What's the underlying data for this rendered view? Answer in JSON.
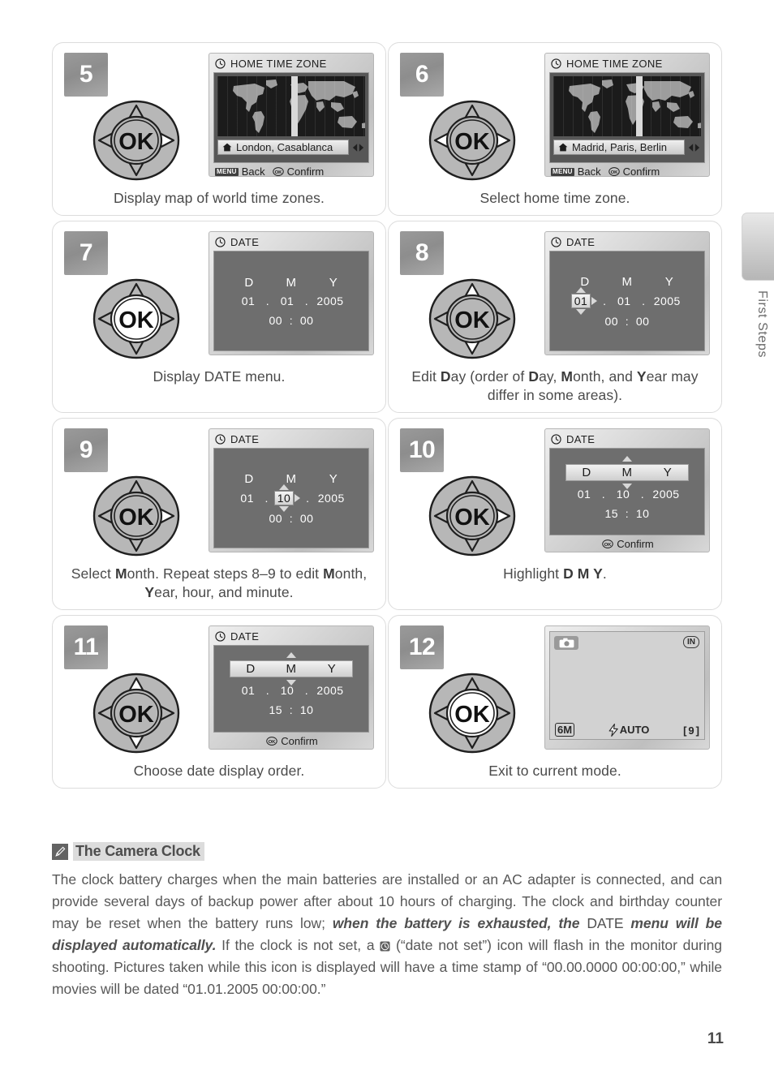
{
  "page": {
    "number": "11",
    "side_tab_label": "First Steps"
  },
  "steps": [
    {
      "number": "5",
      "caption": "Display map of world time zones.",
      "selector_highlight": "right",
      "screen": {
        "type": "timezone",
        "title": "HOME TIME ZONE",
        "zone": "London, Casablanca",
        "back_label": "Back",
        "confirm_label": "Confirm",
        "menu_tag": "MENU",
        "band_position_pct": 50
      }
    },
    {
      "number": "6",
      "caption": "Select home time zone.",
      "selector_highlight": "left-right",
      "screen": {
        "type": "timezone",
        "title": "HOME TIME ZONE",
        "zone": "Madrid, Paris, Berlin",
        "back_label": "Back",
        "confirm_label": "Confirm",
        "menu_tag": "MENU",
        "band_position_pct": 56
      }
    },
    {
      "number": "7",
      "caption": "Display DATE menu.",
      "caption_html": "Display DATE menu.",
      "selector_highlight": "center",
      "screen": {
        "type": "date",
        "title": "DATE",
        "headers": [
          "D",
          "M",
          "Y"
        ],
        "header_boxed": false,
        "day": "01",
        "month": "01",
        "year": "2005",
        "hour": "00",
        "minute": "00",
        "selected_field": "none",
        "show_time": true,
        "footer": ""
      }
    },
    {
      "number": "8",
      "caption_html": "Edit <b>D</b>ay (order of <b>D</b>ay, <b>M</b>onth, and <b>Y</b>ear may differ in some areas).",
      "selector_highlight": "up-down",
      "screen": {
        "type": "date",
        "title": "DATE",
        "headers": [
          "D",
          "M",
          "Y"
        ],
        "header_boxed": false,
        "day": "01",
        "month": "01",
        "year": "2005",
        "hour": "00",
        "minute": "00",
        "selected_field": "day",
        "show_time": true,
        "footer": ""
      }
    },
    {
      "number": "9",
      "caption_html": "Select <b>M</b>onth.  Repeat steps 8–9 to edit <b>M</b>onth, <b>Y</b>ear, hour, and minute.",
      "selector_highlight": "right",
      "screen": {
        "type": "date",
        "title": "DATE",
        "headers": [
          "D",
          "M",
          "Y"
        ],
        "header_boxed": false,
        "day": "01",
        "month": "10",
        "year": "2005",
        "hour": "00",
        "minute": "00",
        "selected_field": "month",
        "show_time": true,
        "footer": ""
      }
    },
    {
      "number": "10",
      "caption_html": "Highlight <b>D M Y</b>.",
      "selector_highlight": "right",
      "screen": {
        "type": "date",
        "title": "DATE",
        "headers": [
          "D",
          "M",
          "Y"
        ],
        "header_boxed": true,
        "day": "01",
        "month": "10",
        "year": "2005",
        "hour": "15",
        "minute": "10",
        "selected_field": "header",
        "show_time": true,
        "footer": "Confirm"
      }
    },
    {
      "number": "11",
      "caption_html": "Choose date display order.",
      "selector_highlight": "up-down",
      "screen": {
        "type": "date",
        "title": "DATE",
        "headers": [
          "D",
          "M",
          "Y"
        ],
        "header_boxed": true,
        "day": "01",
        "month": "10",
        "year": "2005",
        "hour": "15",
        "minute": "10",
        "selected_field": "header",
        "show_time": true,
        "footer": "Confirm"
      }
    },
    {
      "number": "12",
      "caption_html": "Exit to current mode.",
      "selector_highlight": "center",
      "screen": {
        "type": "shooting",
        "mode_icon": "camera-icon",
        "memory_tag": "IN",
        "image_size": "6M",
        "flash_mode": "AUTO",
        "shots_remaining": "9"
      }
    }
  ],
  "note": {
    "title": "The Camera Clock",
    "icon": "pencil-icon",
    "paragraph_html": "The clock battery charges when the main batteries are installed or an AC adapter is connected, and can provide several days of backup power after about 10 hours of charging.  The clock and birthday counter may be reset when the battery runs low; <i>when the battery is exhausted, the <span class=\"roman\">DATE</span> menu will be displayed automatically.</i>  If the clock is not set, a <span class=\"inline-clock-ph\"></span> (“date not set”) icon will flash in the monitor during shooting. Pictures taken while this icon is displayed will have a time stamp of  “00.00.0000 00:00:00,” while movies will be dated “01.01.2005 00:00:00.”"
  },
  "colors": {
    "badge_gray": "#9a9a9a",
    "text_gray": "#585858",
    "lcd_dark": "#6e6e6e",
    "map_black": "#1b1b1b",
    "highlight_white": "#ffffff"
  }
}
